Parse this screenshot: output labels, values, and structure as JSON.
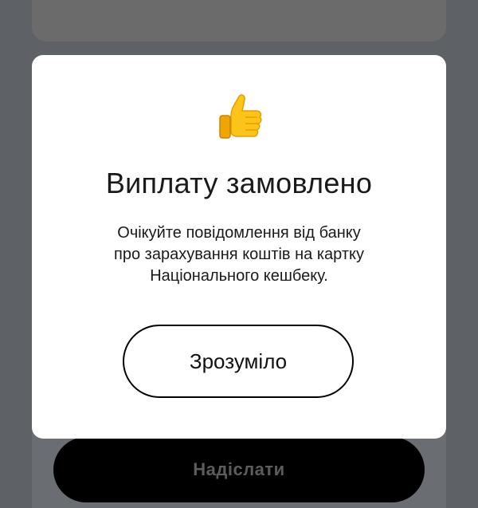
{
  "modal": {
    "icon": "thumbs-up-icon",
    "title": "Виплату замовлено",
    "message_lines": [
      "Очікуйте повідомлення від банку",
      "про зарахування коштів на картку",
      "Національного кешбеку."
    ],
    "ok_label": "Зрозуміло"
  },
  "background": {
    "send_label": "Надіслати"
  },
  "colors": {
    "overlay": "#5e6166",
    "modal_bg": "#ffffff",
    "emoji_yellow": "#fcc419",
    "send_button_bg": "#000000"
  }
}
